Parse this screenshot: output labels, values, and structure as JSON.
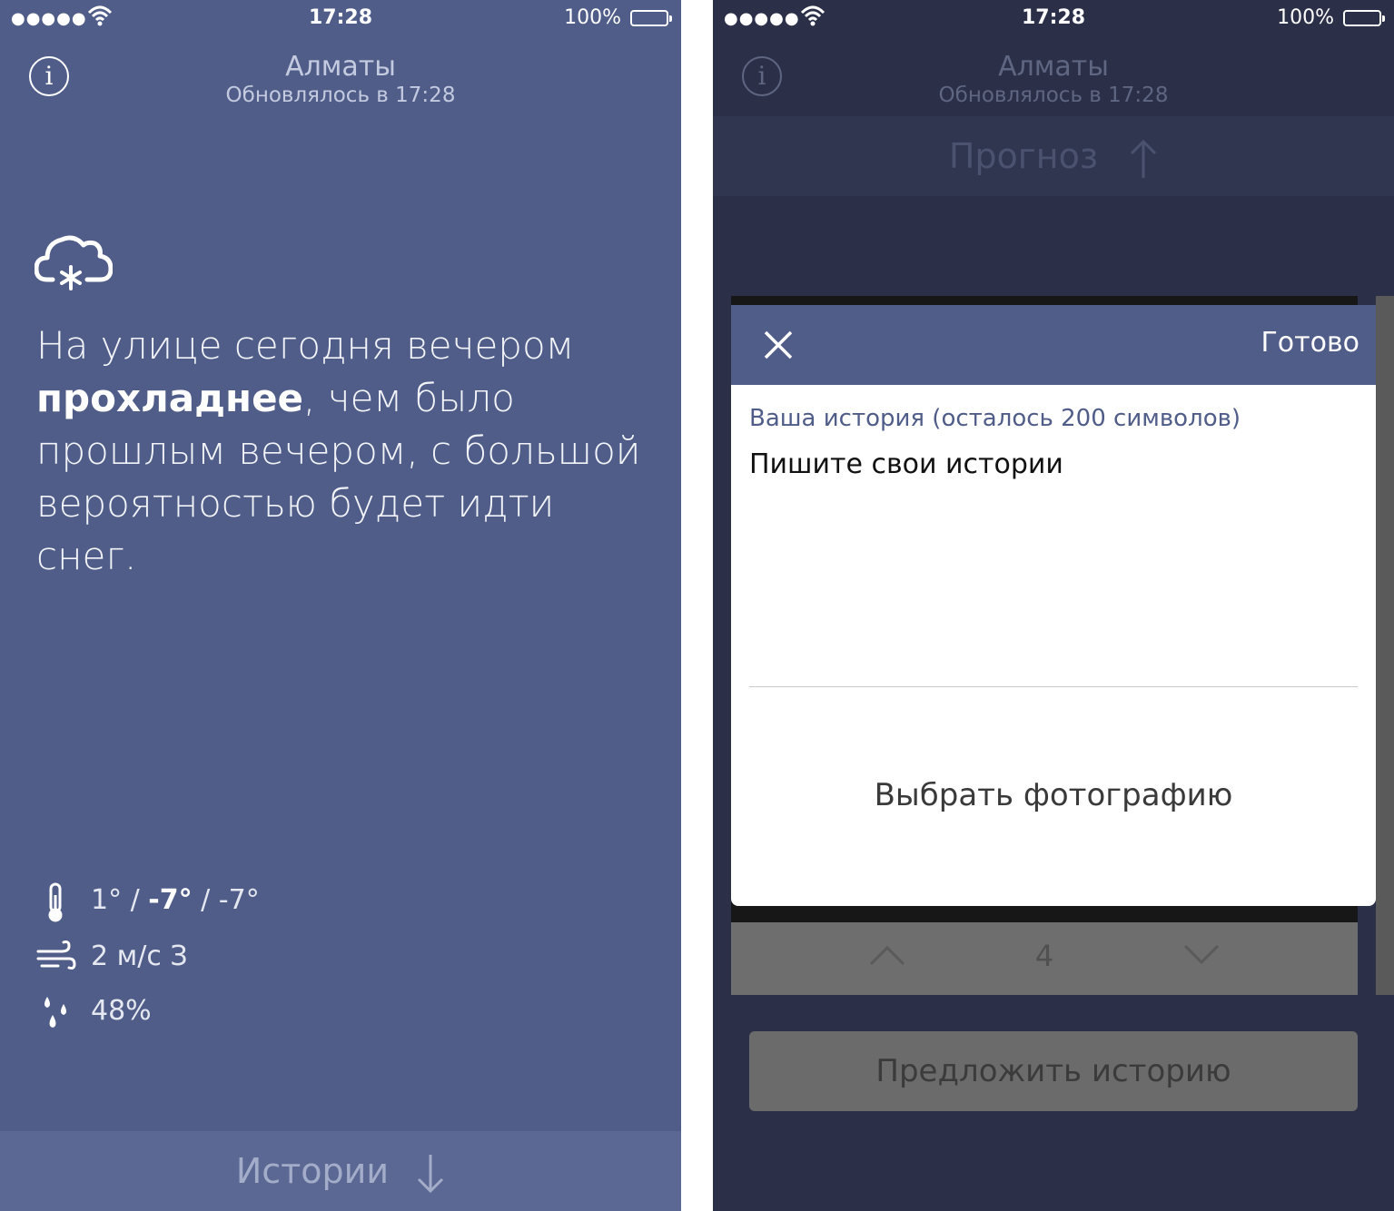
{
  "status": {
    "signal": "●●●●●",
    "time": "17:28",
    "battery": "100%"
  },
  "header": {
    "city": "Алматы",
    "updated": "Обновлялось в 17:28"
  },
  "left": {
    "weather_icon": "cloud-snow-icon",
    "forecast": {
      "part1": "На улице сегодня вечером ",
      "bold": "прохладнее",
      "part2": ", чем было прошлым вечером, с большой вероятностью будет идти снег."
    },
    "stats": {
      "temp_a": "1° / ",
      "temp_bold": "-7°",
      "temp_b": " / -7°",
      "wind": "2 м/с З",
      "humidity": "48%"
    },
    "stories_label": "Истории"
  },
  "right": {
    "forecast_label": "Прогноз",
    "modal": {
      "done": "Готово",
      "hint": "Ваша история (осталось 200 символов)",
      "placeholder": "Пишите свои истории",
      "choose_photo": "Выбрать фотографию"
    },
    "pager_number": "4",
    "suggest": "Предложить историю"
  },
  "colors": {
    "left_bg": "#4f5d88",
    "right_bg": "#2b3048",
    "accent": "#4f5d88"
  }
}
